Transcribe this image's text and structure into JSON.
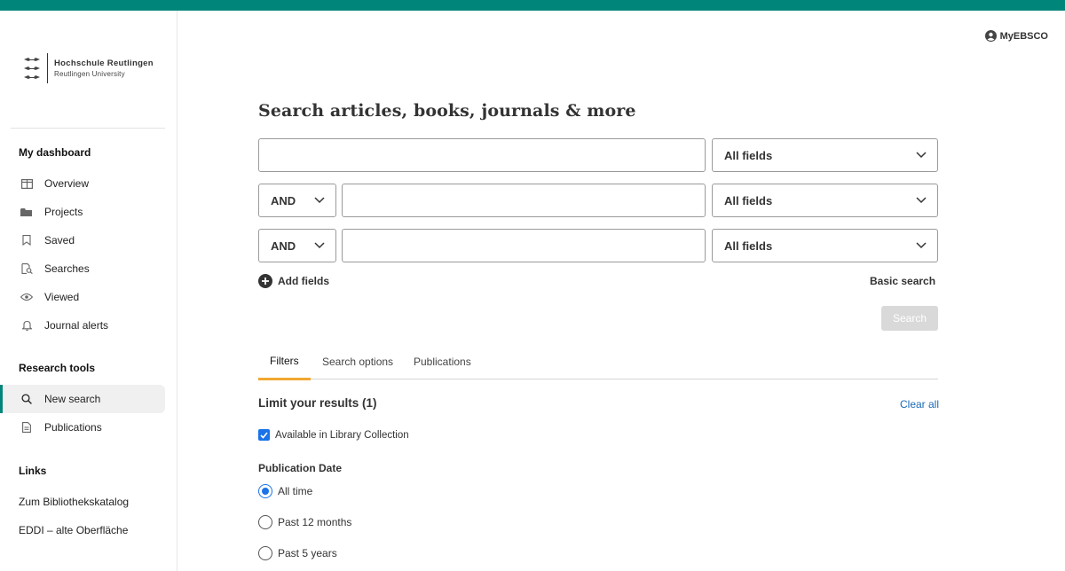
{
  "brand": {
    "line1": "Hochschule Reutlingen",
    "line2": "Reutlingen University",
    "accent_color": "#00857a"
  },
  "header": {
    "account_label": "MyEBSCO"
  },
  "sidebar": {
    "dashboard_heading": "My dashboard",
    "dashboard_items": [
      {
        "label": "Overview",
        "icon": "overview-icon"
      },
      {
        "label": "Projects",
        "icon": "folder-icon"
      },
      {
        "label": "Saved",
        "icon": "bookmark-icon"
      },
      {
        "label": "Searches",
        "icon": "saved-search-icon"
      },
      {
        "label": "Viewed",
        "icon": "eye-icon"
      },
      {
        "label": "Journal alerts",
        "icon": "bell-icon"
      }
    ],
    "tools_heading": "Research tools",
    "tools_items": [
      {
        "label": "New search",
        "icon": "search-icon",
        "active": true
      },
      {
        "label": "Publications",
        "icon": "document-icon",
        "active": false
      }
    ],
    "links_heading": "Links",
    "links": [
      {
        "label": "Zum Bibliothekskatalog"
      },
      {
        "label": "EDDI – alte Oberfläche"
      }
    ]
  },
  "search": {
    "title": "Search articles, books, journals & more",
    "rows": [
      {
        "operator": "",
        "query": "",
        "field": "All fields"
      },
      {
        "operator": "AND",
        "query": "",
        "field": "All fields"
      },
      {
        "operator": "AND",
        "query": "",
        "field": "All fields"
      }
    ],
    "add_fields_label": "Add fields",
    "basic_search_label": "Basic search",
    "search_button_label": "Search"
  },
  "tabs": [
    {
      "label": "Filters",
      "active": true
    },
    {
      "label": "Search options",
      "active": false
    },
    {
      "label": "Publications",
      "active": false
    }
  ],
  "filters": {
    "limit_title": "Limit your results (1)",
    "clear_all_label": "Clear all",
    "library_collection_label": "Available in Library Collection",
    "library_collection_checked": true,
    "pub_date_label": "Publication Date",
    "pub_date_options": [
      {
        "label": "All time",
        "checked": true
      },
      {
        "label": "Past 12 months",
        "checked": false
      },
      {
        "label": "Past 5 years",
        "checked": false
      }
    ]
  }
}
